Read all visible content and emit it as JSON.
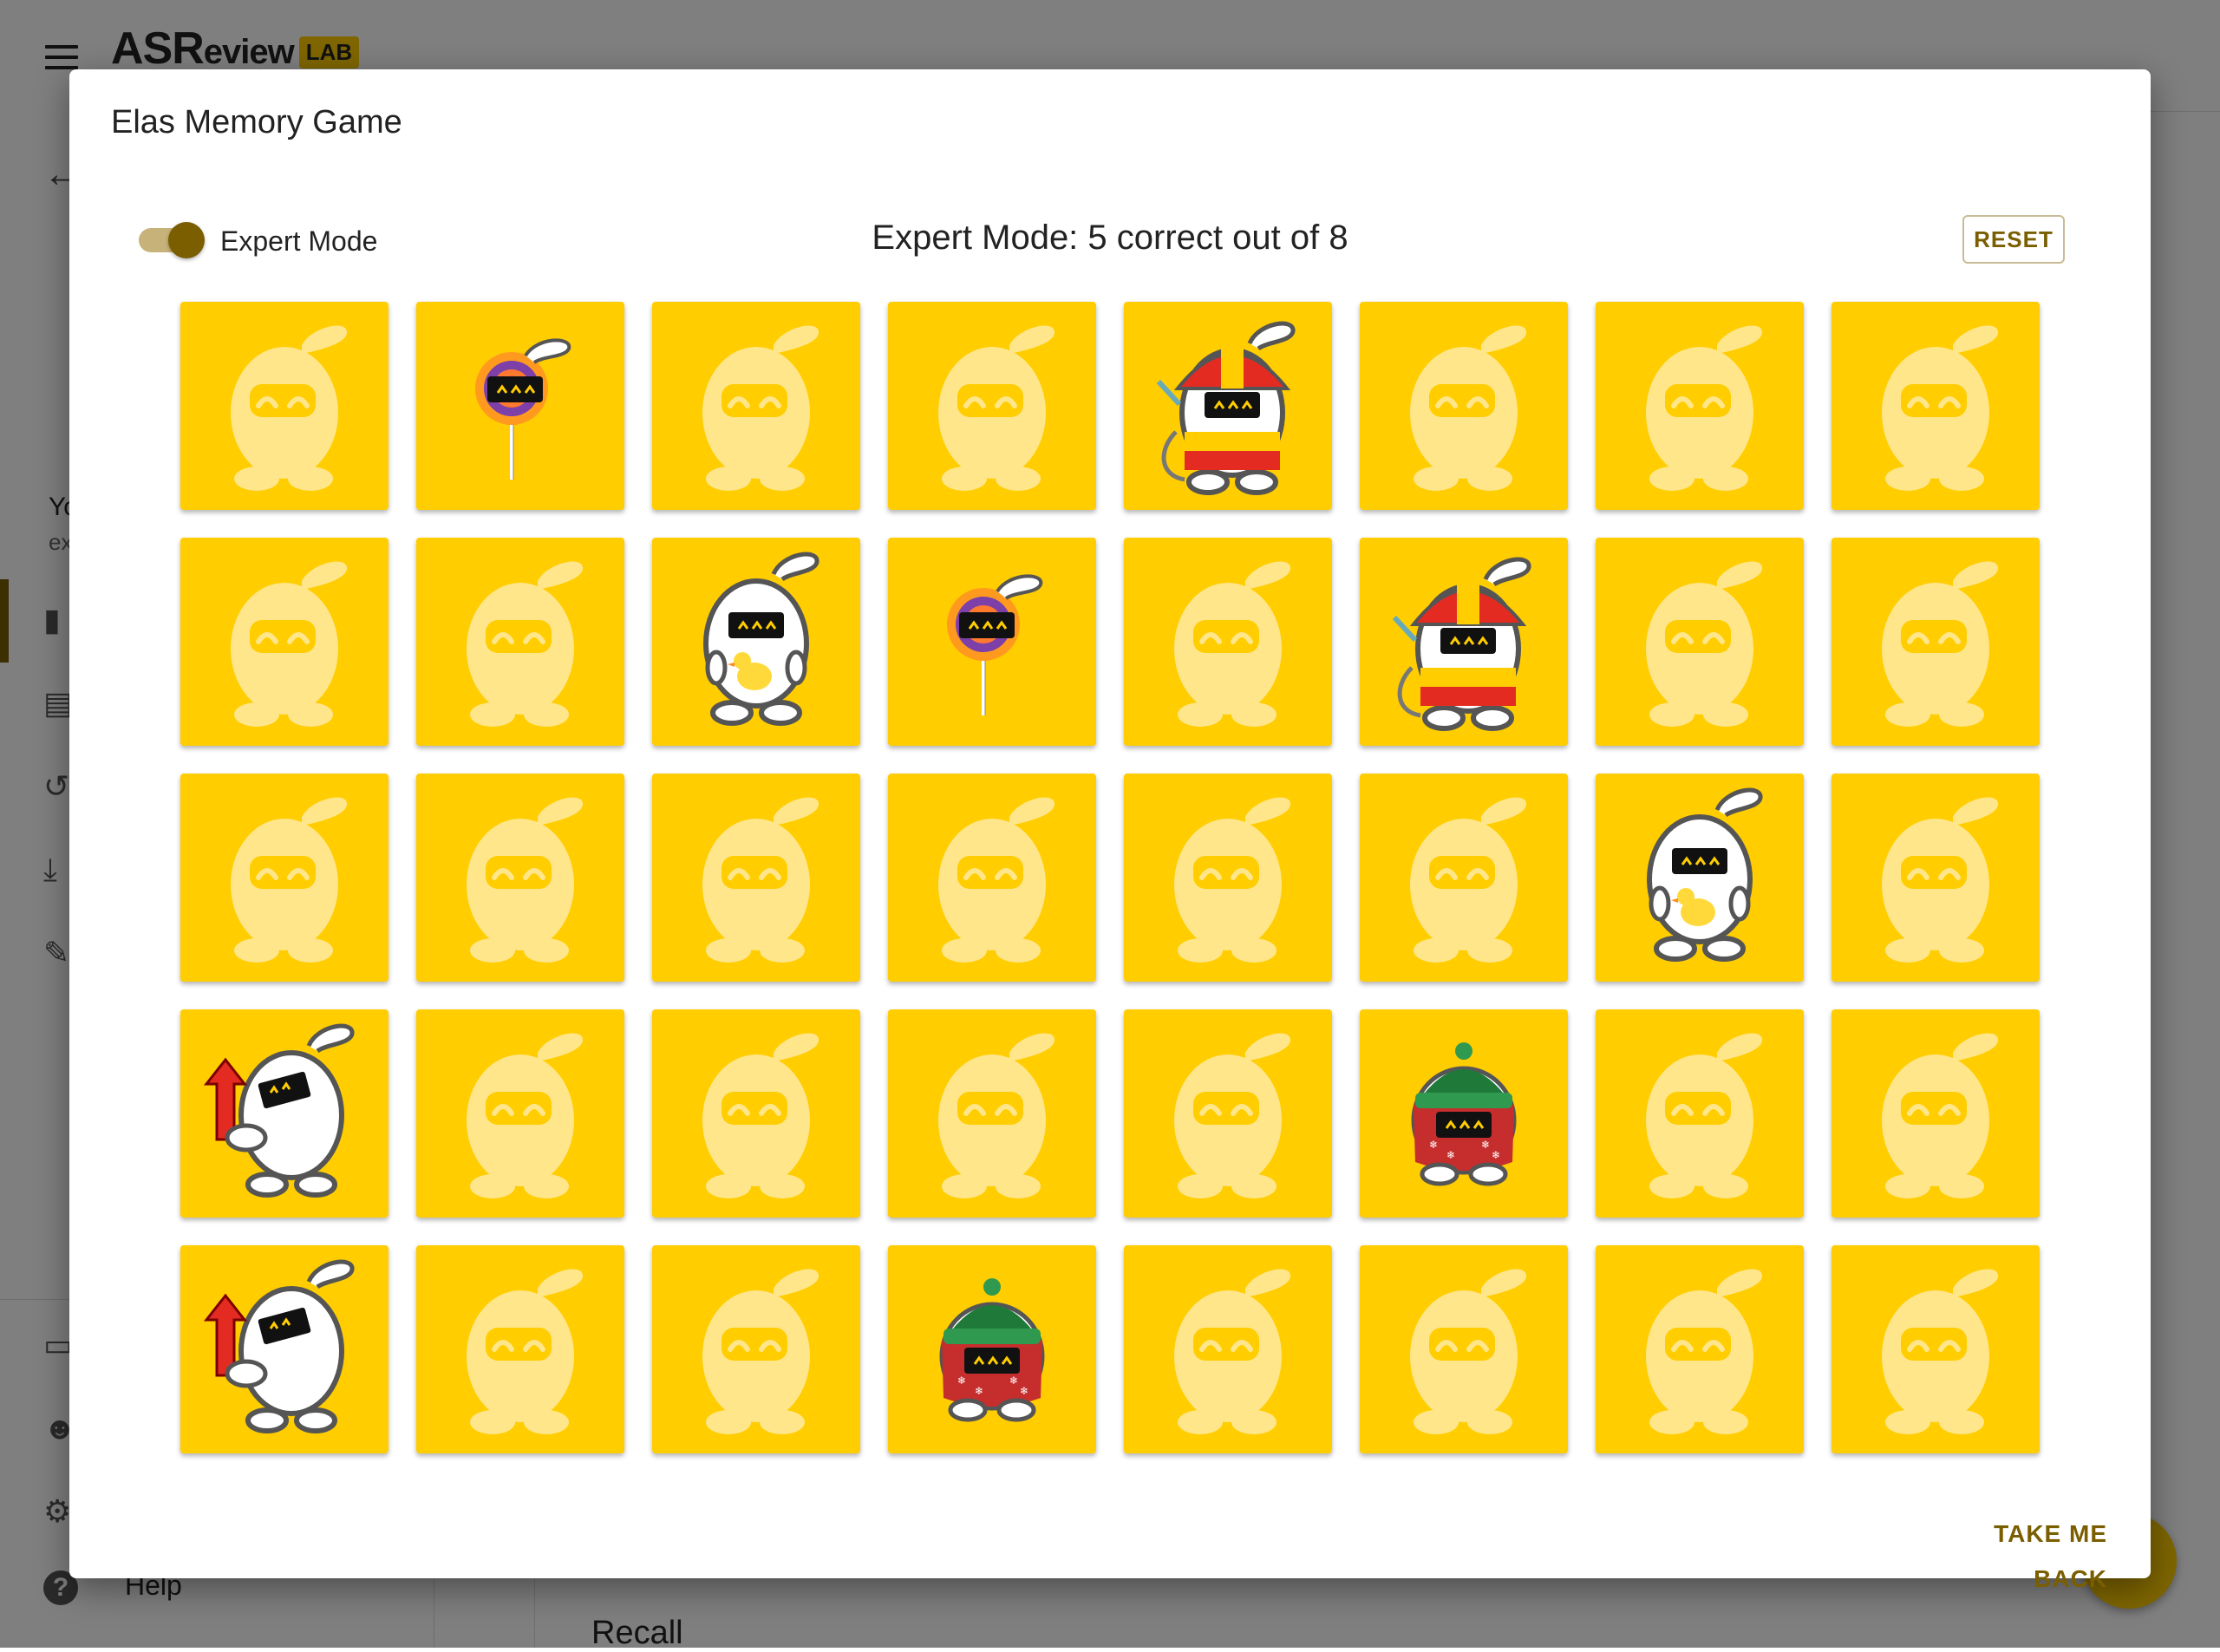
{
  "app": {
    "logo_asr": "ASR",
    "logo_review": "eview",
    "logo_lab": "LAB"
  },
  "sidebar": {
    "you_text": "Yo",
    "ex_text": "ex",
    "help_label": "Help",
    "help_glyph": "?"
  },
  "content": {
    "recall_label": "Recall"
  },
  "dialog": {
    "title": "Elas Memory Game",
    "toggle_label": "Expert Mode",
    "toggle_on": true,
    "score_text": "Expert Mode: 5 correct out of 8",
    "reset_label": "RESET",
    "back_label": "TAKE ME BACK"
  },
  "colors": {
    "card": "#ffcd00",
    "accent": "#7a5e00",
    "card_back_figure": "#ffe68a"
  },
  "board": {
    "columns": 8,
    "rows": [
      [
        "back",
        "lollipop",
        "back",
        "back",
        "firefighter",
        "back",
        "back",
        "back"
      ],
      [
        "back",
        "back",
        "duck",
        "lollipop",
        "back",
        "firefighter",
        "back",
        "back"
      ],
      [
        "back",
        "back",
        "back",
        "back",
        "back",
        "back",
        "duck",
        "back"
      ],
      [
        "arrow",
        "back",
        "back",
        "back",
        "back",
        "winter",
        "back",
        "back"
      ],
      [
        "arrow",
        "back",
        "back",
        "winter",
        "back",
        "back",
        "back",
        "back"
      ]
    ]
  }
}
